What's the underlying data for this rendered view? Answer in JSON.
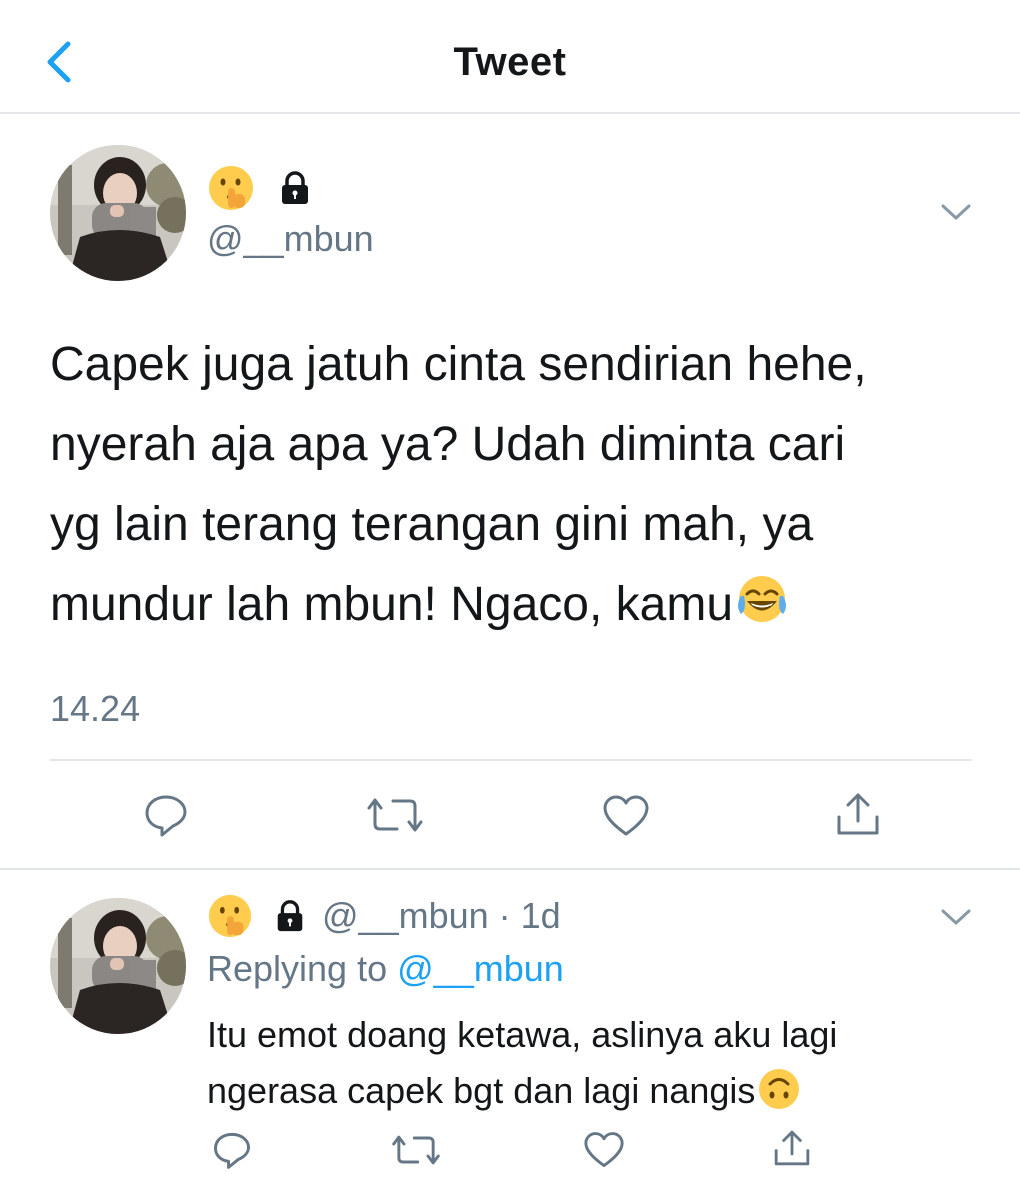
{
  "header": {
    "title": "Tweet",
    "back_icon": "chevron-left-icon"
  },
  "colors": {
    "accent": "#1da1f2",
    "text": "#14171a",
    "muted": "#657786",
    "divider": "#e3e6e8"
  },
  "main_tweet": {
    "display_name_emoji": "shushing-face-emoji",
    "lock_icon": "lock-icon",
    "handle": "@__mbun",
    "text_lines": [
      "Capek juga jatuh cinta sendirian hehe,",
      "nyerah aja apa ya? Udah diminta cari",
      "yg lain terang terangan gini mah, ya",
      "mundur lah mbun! Ngaco, kamu"
    ],
    "trailing_emoji": "laughing-crying-face-emoji",
    "timestamp": "14.24",
    "actions": [
      "reply-icon",
      "retweet-icon",
      "like-icon",
      "share-icon"
    ]
  },
  "reply_tweet": {
    "display_name_emoji": "shushing-face-emoji",
    "lock_icon": "lock-icon",
    "meta": "@__mbun · 1d",
    "replying_prefix": "Replying to",
    "replying_handle": "@__mbun",
    "text_lines": [
      "Itu emot doang ketawa, aslinya aku lagi",
      "ngerasa capek bgt dan lagi nangis"
    ],
    "trailing_emoji": "upside-down-face-emoji",
    "actions": [
      "reply-icon",
      "retweet-icon",
      "like-icon",
      "share-icon"
    ]
  }
}
